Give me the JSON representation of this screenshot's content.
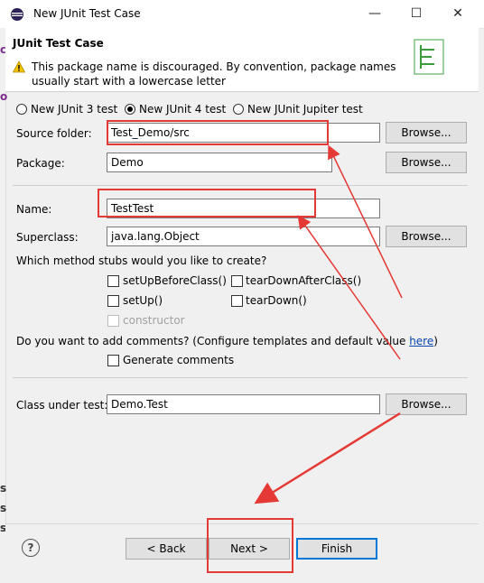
{
  "window": {
    "title": "New JUnit Test Case",
    "minimize": "—",
    "maximize": "☐",
    "close": "✕"
  },
  "header": {
    "title": "JUnit Test Case",
    "warning": "This package name is discouraged. By convention, package names usually start with a lowercase letter"
  },
  "radios": [
    {
      "label": "New JUnit 3 test",
      "selected": false
    },
    {
      "label": "New JUnit 4 test",
      "selected": true
    },
    {
      "label": "New JUnit Jupiter test",
      "selected": false
    }
  ],
  "fields": {
    "source_folder": {
      "label": "Source folder:",
      "value": "Test_Demo/src",
      "button": "Browse..."
    },
    "package": {
      "label": "Package:",
      "value": "Demo",
      "button": "Browse..."
    },
    "name": {
      "label": "Name:",
      "value": "TestTest"
    },
    "superclass": {
      "label": "Superclass:",
      "value": "java.lang.Object",
      "button": "Browse..."
    },
    "class_under_test": {
      "label": "Class under test:",
      "value": "Demo.Test",
      "button": "Browse..."
    }
  },
  "stubs": {
    "question": "Which method stubs would you like to create?",
    "items": [
      {
        "label": "setUpBeforeClass()",
        "checked": false,
        "enabled": true
      },
      {
        "label": "tearDownAfterClass()",
        "checked": false,
        "enabled": true
      },
      {
        "label": "setUp()",
        "checked": false,
        "enabled": true
      },
      {
        "label": "tearDown()",
        "checked": false,
        "enabled": true
      },
      {
        "label": "constructor",
        "checked": false,
        "enabled": false
      }
    ]
  },
  "comments": {
    "question": "Do you want to add comments? (Configure templates and default value ",
    "link": "here",
    "close_paren": ")",
    "generate_label": "Generate comments",
    "checked": false
  },
  "buttons": {
    "back": "< Back",
    "next": "Next >",
    "finish": "Finish",
    "help": "?"
  },
  "left_strip_chars": [
    "c",
    "o",
    "s",
    "s",
    "s"
  ],
  "colors": {
    "annotation": "#e53935",
    "link": "#0645ad"
  }
}
